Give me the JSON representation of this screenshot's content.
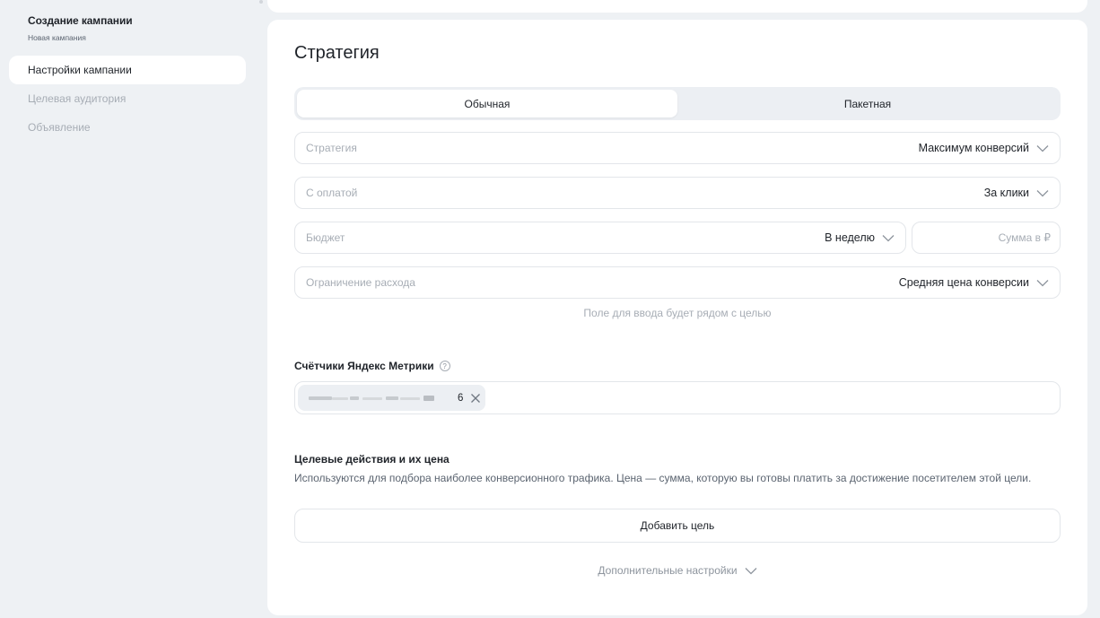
{
  "sidebar": {
    "title": "Создание кампании",
    "subtitle": "Новая кампания",
    "items": [
      {
        "label": "Настройки кампании",
        "state": "active"
      },
      {
        "label": "Целевая аудитория",
        "state": "inactive"
      },
      {
        "label": "Объявление",
        "state": "inactive"
      }
    ]
  },
  "strategy": {
    "title": "Стратегия",
    "tabs": [
      {
        "label": "Обычная",
        "selected": true
      },
      {
        "label": "Пакетная",
        "selected": false
      }
    ],
    "fields": {
      "strategy": {
        "label": "Стратегия",
        "value": "Максимум конверсий"
      },
      "payment": {
        "label": "С оплатой",
        "value": "За клики"
      },
      "budget": {
        "label": "Бюджет",
        "value": "В неделю"
      },
      "sum": {
        "placeholder": "Сумма в ₽"
      },
      "limit": {
        "label": "Ограничение расхода",
        "value": "Средняя цена конверсии"
      }
    },
    "hint": "Поле для ввода будет рядом с целью"
  },
  "metrika": {
    "label": "Счётчики Яндекс Метрики",
    "chip_suffix": "6"
  },
  "goals": {
    "title": "Целевые действия и их цена",
    "description": "Используются для подбора наиболее конверсионного трафика. Цена — сумма, которую вы готовы платить за достижение посетителем этой цели.",
    "add_label": "Добавить цель"
  },
  "more_settings": "Дополнительные настройки",
  "icons": {
    "dropdown": "chevron-down-icon",
    "help": "question-circle-icon",
    "remove": "close-icon"
  },
  "colors": {
    "background": "#eef1f4",
    "card": "#ffffff",
    "muted_text": "#a7adb5"
  }
}
